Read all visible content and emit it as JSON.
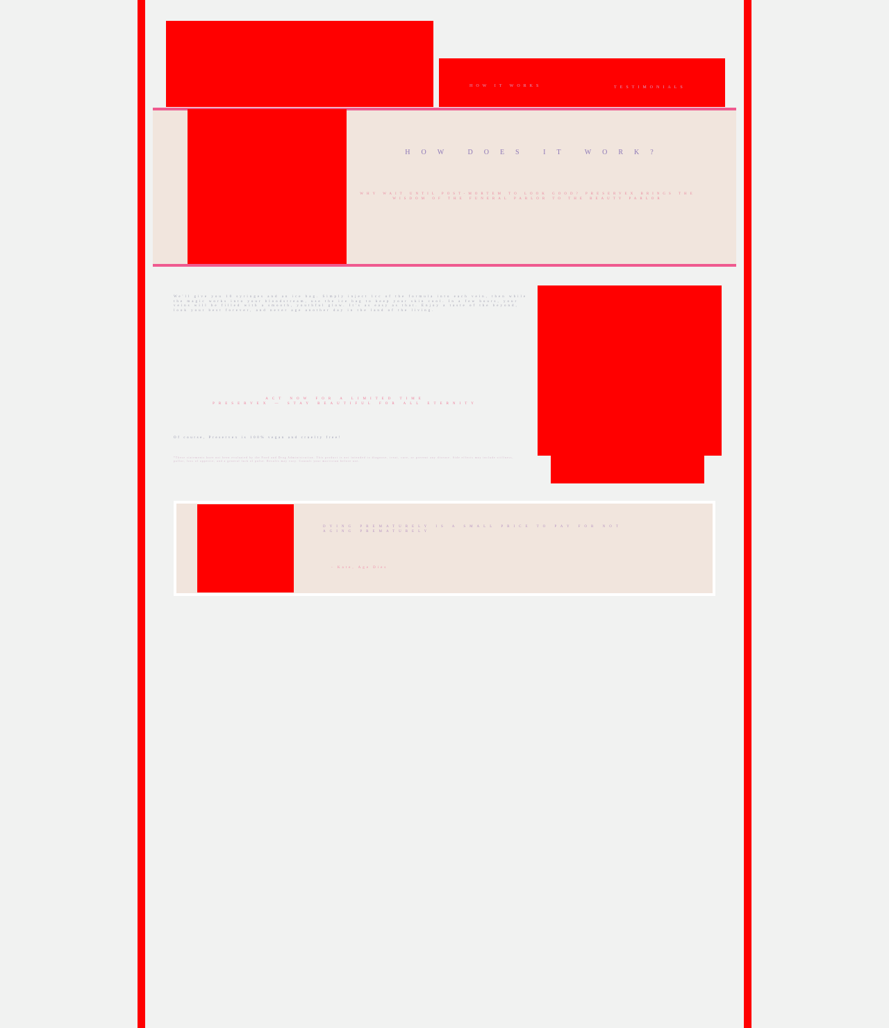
{
  "nav": {
    "links": [
      {
        "label": "HOW IT WORKS"
      },
      {
        "label": "TESTIMONIALS"
      }
    ]
  },
  "hero": {
    "heading": "HOW DOES IT WORK?",
    "text": "WHY WAIT UNTIL POST-MORTEM TO LOOK GOOD? PRESERVEX BRINGS THE WISDOM OF THE FUNERAL PARLOR TO THE BEAUTY PARLOR"
  },
  "main": {
    "description": "We'll give you 10 syringes and an ice bag. Simply inject 1cc of the formula into each vein, then while the magic works into your bloodstream, use the ice bag to keep your skin cool. In a few hours, your veins will be filled with a smooth, youthful glow. It's as easy as that. Enjoy a taste of the beyond, look your best forever, and never age another day in the land of the living.",
    "slogan_top": "ACT NOW FOR A LIMITED TIME",
    "slogan_bottom": "PRESERVEX — STAY BEAUTIFUL FOR ALL ETERNITY",
    "question": "Of course, Preservex is 100% vegan and cruelty free!",
    "fine_print": "*These statements have not been evaluated by the Food and Drug Administration. This product is not intended to diagnose, treat, cure, or prevent any disease. Side effects may include stiffness, pallor, loss of appetite, and a general lack of pulse. Results may vary. Consult your mortician before use."
  },
  "testimonial": {
    "quote": "DYING PREMATURELY IS A SMALL PRICE TO PAY FOR NOT AGING PREMATURELY",
    "author": "- Kate, Age Dies"
  },
  "colors": {
    "placeholder": "#ff0000",
    "accent_pink": "#ef5a8f",
    "hero_bg": "#f1e5dd",
    "page_bg": "#f1f2f1",
    "heading_purple": "#8e79b8"
  }
}
